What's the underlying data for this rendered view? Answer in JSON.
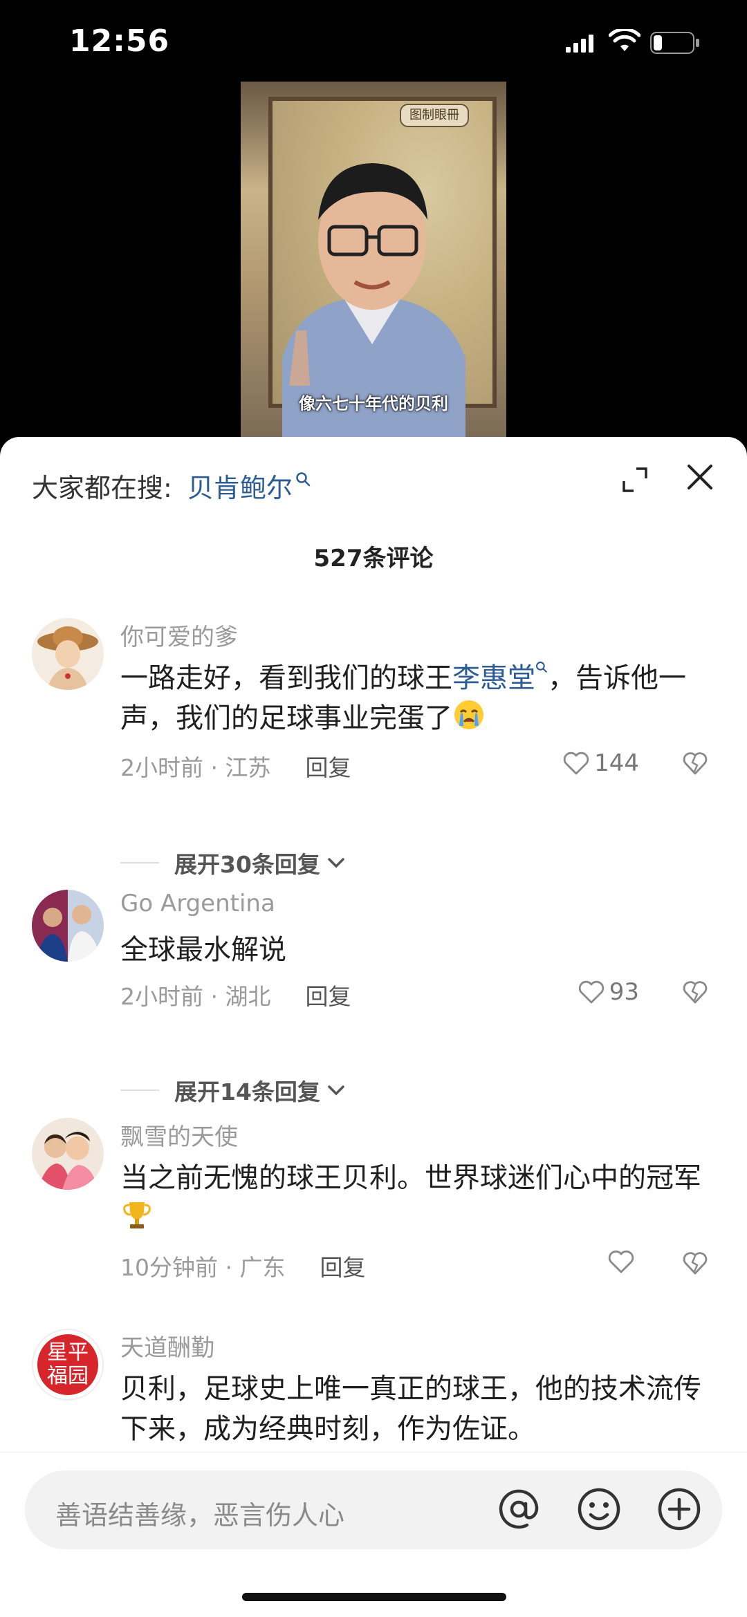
{
  "status": {
    "time": "12:56"
  },
  "video": {
    "map_label": "图制眼冊",
    "caption": "像六七十年代的贝利"
  },
  "search": {
    "prefix": "大家都在搜:",
    "term": "贝肯鲍尔"
  },
  "comment_count": "527条评论",
  "comments": [
    {
      "name": "你可爱的爹",
      "text_before": "一路走好，看到我们的球王",
      "link": "李惠堂",
      "text_after": "，告诉他一声，我们的足球事业完蛋了",
      "time_loc": "2小时前 · 江苏",
      "reply": "回复",
      "likes": "144",
      "expand": "展开30条回复"
    },
    {
      "name": "Go Argentina",
      "text": "全球最水解说",
      "time_loc": "2小时前 · 湖北",
      "reply": "回复",
      "likes": "93",
      "expand": "展开14条回复"
    },
    {
      "name": "飘雪的天使",
      "text": "当之前无愧的球王贝利。世界球迷们心中的冠军",
      "time_loc": "10分钟前 · 广东",
      "reply": "回复",
      "likes": ""
    },
    {
      "name": "天道酬勤",
      "avatar_text": "星平福园",
      "text": "贝利，足球史上唯一真正的球王，他的技术流传下来，成为经典时刻，作为佐证。"
    }
  ],
  "input": {
    "placeholder": "善语结善缘，恶言伤人心"
  }
}
